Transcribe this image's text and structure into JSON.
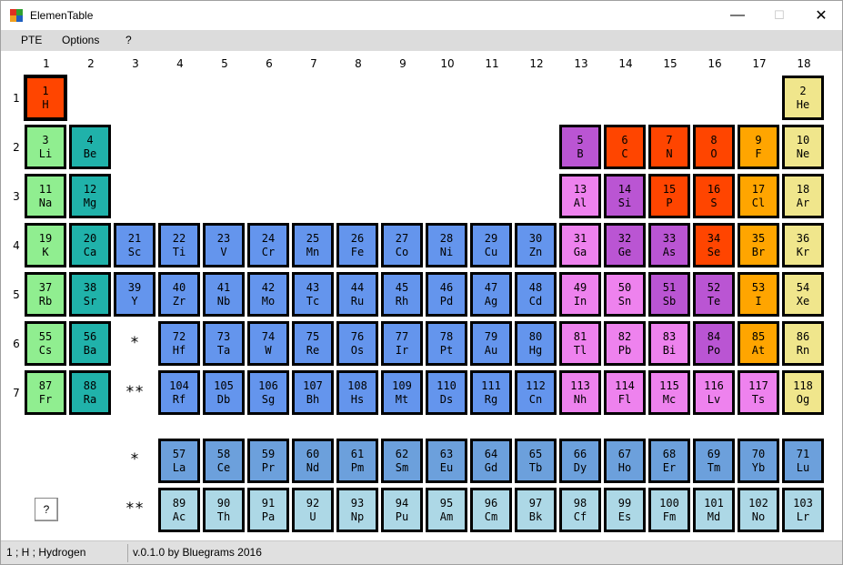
{
  "window": {
    "title": "ElemenTable"
  },
  "controls": {
    "minimize": "—",
    "maximize": "☐",
    "close": "✕"
  },
  "menu": {
    "items": [
      "PTE",
      "Options",
      "?"
    ]
  },
  "groups": [
    "1",
    "2",
    "3",
    "4",
    "5",
    "6",
    "7",
    "8",
    "9",
    "10",
    "11",
    "12",
    "13",
    "14",
    "15",
    "16",
    "17",
    "18"
  ],
  "periods": [
    "1",
    "2",
    "3",
    "4",
    "5",
    "6",
    "7"
  ],
  "markers": {
    "lanthanide": "*",
    "actinide": "**"
  },
  "help_button": "?",
  "colors": {
    "alkali": "#90ee90",
    "alkaline_earth": "#20b2aa",
    "transition": "#6495ed",
    "post_transition": "#ee82ee",
    "metalloid": "#ba55d3",
    "nonmetal": "#ff4500",
    "halogen": "#ffa500",
    "noble_gas": "#f0e68c",
    "lanthanide": "#6ca0dc",
    "actinide": "#add8e6"
  },
  "elements": [
    {
      "n": "1",
      "s": "H",
      "cat": "nonmetal",
      "g": 1,
      "p": 1
    },
    {
      "n": "2",
      "s": "He",
      "cat": "noble_gas",
      "g": 18,
      "p": 1
    },
    {
      "n": "3",
      "s": "Li",
      "cat": "alkali",
      "g": 1,
      "p": 2
    },
    {
      "n": "4",
      "s": "Be",
      "cat": "alkaline_earth",
      "g": 2,
      "p": 2
    },
    {
      "n": "5",
      "s": "B",
      "cat": "metalloid",
      "g": 13,
      "p": 2
    },
    {
      "n": "6",
      "s": "C",
      "cat": "nonmetal",
      "g": 14,
      "p": 2
    },
    {
      "n": "7",
      "s": "N",
      "cat": "nonmetal",
      "g": 15,
      "p": 2
    },
    {
      "n": "8",
      "s": "O",
      "cat": "nonmetal",
      "g": 16,
      "p": 2
    },
    {
      "n": "9",
      "s": "F",
      "cat": "halogen",
      "g": 17,
      "p": 2
    },
    {
      "n": "10",
      "s": "Ne",
      "cat": "noble_gas",
      "g": 18,
      "p": 2
    },
    {
      "n": "11",
      "s": "Na",
      "cat": "alkali",
      "g": 1,
      "p": 3
    },
    {
      "n": "12",
      "s": "Mg",
      "cat": "alkaline_earth",
      "g": 2,
      "p": 3
    },
    {
      "n": "13",
      "s": "Al",
      "cat": "post_transition",
      "g": 13,
      "p": 3
    },
    {
      "n": "14",
      "s": "Si",
      "cat": "metalloid",
      "g": 14,
      "p": 3
    },
    {
      "n": "15",
      "s": "P",
      "cat": "nonmetal",
      "g": 15,
      "p": 3
    },
    {
      "n": "16",
      "s": "S",
      "cat": "nonmetal",
      "g": 16,
      "p": 3
    },
    {
      "n": "17",
      "s": "Cl",
      "cat": "halogen",
      "g": 17,
      "p": 3
    },
    {
      "n": "18",
      "s": "Ar",
      "cat": "noble_gas",
      "g": 18,
      "p": 3
    },
    {
      "n": "19",
      "s": "K",
      "cat": "alkali",
      "g": 1,
      "p": 4
    },
    {
      "n": "20",
      "s": "Ca",
      "cat": "alkaline_earth",
      "g": 2,
      "p": 4
    },
    {
      "n": "21",
      "s": "Sc",
      "cat": "transition",
      "g": 3,
      "p": 4
    },
    {
      "n": "22",
      "s": "Ti",
      "cat": "transition",
      "g": 4,
      "p": 4
    },
    {
      "n": "23",
      "s": "V",
      "cat": "transition",
      "g": 5,
      "p": 4
    },
    {
      "n": "24",
      "s": "Cr",
      "cat": "transition",
      "g": 6,
      "p": 4
    },
    {
      "n": "25",
      "s": "Mn",
      "cat": "transition",
      "g": 7,
      "p": 4
    },
    {
      "n": "26",
      "s": "Fe",
      "cat": "transition",
      "g": 8,
      "p": 4
    },
    {
      "n": "27",
      "s": "Co",
      "cat": "transition",
      "g": 9,
      "p": 4
    },
    {
      "n": "28",
      "s": "Ni",
      "cat": "transition",
      "g": 10,
      "p": 4
    },
    {
      "n": "29",
      "s": "Cu",
      "cat": "transition",
      "g": 11,
      "p": 4
    },
    {
      "n": "30",
      "s": "Zn",
      "cat": "transition",
      "g": 12,
      "p": 4
    },
    {
      "n": "31",
      "s": "Ga",
      "cat": "post_transition",
      "g": 13,
      "p": 4
    },
    {
      "n": "32",
      "s": "Ge",
      "cat": "metalloid",
      "g": 14,
      "p": 4
    },
    {
      "n": "33",
      "s": "As",
      "cat": "metalloid",
      "g": 15,
      "p": 4
    },
    {
      "n": "34",
      "s": "Se",
      "cat": "nonmetal",
      "g": 16,
      "p": 4
    },
    {
      "n": "35",
      "s": "Br",
      "cat": "halogen",
      "g": 17,
      "p": 4
    },
    {
      "n": "36",
      "s": "Kr",
      "cat": "noble_gas",
      "g": 18,
      "p": 4
    },
    {
      "n": "37",
      "s": "Rb",
      "cat": "alkali",
      "g": 1,
      "p": 5
    },
    {
      "n": "38",
      "s": "Sr",
      "cat": "alkaline_earth",
      "g": 2,
      "p": 5
    },
    {
      "n": "39",
      "s": "Y",
      "cat": "transition",
      "g": 3,
      "p": 5
    },
    {
      "n": "40",
      "s": "Zr",
      "cat": "transition",
      "g": 4,
      "p": 5
    },
    {
      "n": "41",
      "s": "Nb",
      "cat": "transition",
      "g": 5,
      "p": 5
    },
    {
      "n": "42",
      "s": "Mo",
      "cat": "transition",
      "g": 6,
      "p": 5
    },
    {
      "n": "43",
      "s": "Tc",
      "cat": "transition",
      "g": 7,
      "p": 5
    },
    {
      "n": "44",
      "s": "Ru",
      "cat": "transition",
      "g": 8,
      "p": 5
    },
    {
      "n": "45",
      "s": "Rh",
      "cat": "transition",
      "g": 9,
      "p": 5
    },
    {
      "n": "46",
      "s": "Pd",
      "cat": "transition",
      "g": 10,
      "p": 5
    },
    {
      "n": "47",
      "s": "Ag",
      "cat": "transition",
      "g": 11,
      "p": 5
    },
    {
      "n": "48",
      "s": "Cd",
      "cat": "transition",
      "g": 12,
      "p": 5
    },
    {
      "n": "49",
      "s": "In",
      "cat": "post_transition",
      "g": 13,
      "p": 5
    },
    {
      "n": "50",
      "s": "Sn",
      "cat": "post_transition",
      "g": 14,
      "p": 5
    },
    {
      "n": "51",
      "s": "Sb",
      "cat": "metalloid",
      "g": 15,
      "p": 5
    },
    {
      "n": "52",
      "s": "Te",
      "cat": "metalloid",
      "g": 16,
      "p": 5
    },
    {
      "n": "53",
      "s": "I",
      "cat": "halogen",
      "g": 17,
      "p": 5
    },
    {
      "n": "54",
      "s": "Xe",
      "cat": "noble_gas",
      "g": 18,
      "p": 5
    },
    {
      "n": "55",
      "s": "Cs",
      "cat": "alkali",
      "g": 1,
      "p": 6
    },
    {
      "n": "56",
      "s": "Ba",
      "cat": "alkaline_earth",
      "g": 2,
      "p": 6
    },
    {
      "n": "72",
      "s": "Hf",
      "cat": "transition",
      "g": 4,
      "p": 6
    },
    {
      "n": "73",
      "s": "Ta",
      "cat": "transition",
      "g": 5,
      "p": 6
    },
    {
      "n": "74",
      "s": "W",
      "cat": "transition",
      "g": 6,
      "p": 6
    },
    {
      "n": "75",
      "s": "Re",
      "cat": "transition",
      "g": 7,
      "p": 6
    },
    {
      "n": "76",
      "s": "Os",
      "cat": "transition",
      "g": 8,
      "p": 6
    },
    {
      "n": "77",
      "s": "Ir",
      "cat": "transition",
      "g": 9,
      "p": 6
    },
    {
      "n": "78",
      "s": "Pt",
      "cat": "transition",
      "g": 10,
      "p": 6
    },
    {
      "n": "79",
      "s": "Au",
      "cat": "transition",
      "g": 11,
      "p": 6
    },
    {
      "n": "80",
      "s": "Hg",
      "cat": "transition",
      "g": 12,
      "p": 6
    },
    {
      "n": "81",
      "s": "Tl",
      "cat": "post_transition",
      "g": 13,
      "p": 6
    },
    {
      "n": "82",
      "s": "Pb",
      "cat": "post_transition",
      "g": 14,
      "p": 6
    },
    {
      "n": "83",
      "s": "Bi",
      "cat": "post_transition",
      "g": 15,
      "p": 6
    },
    {
      "n": "84",
      "s": "Po",
      "cat": "metalloid",
      "g": 16,
      "p": 6
    },
    {
      "n": "85",
      "s": "At",
      "cat": "halogen",
      "g": 17,
      "p": 6
    },
    {
      "n": "86",
      "s": "Rn",
      "cat": "noble_gas",
      "g": 18,
      "p": 6
    },
    {
      "n": "87",
      "s": "Fr",
      "cat": "alkali",
      "g": 1,
      "p": 7
    },
    {
      "n": "88",
      "s": "Ra",
      "cat": "alkaline_earth",
      "g": 2,
      "p": 7
    },
    {
      "n": "104",
      "s": "Rf",
      "cat": "transition",
      "g": 4,
      "p": 7
    },
    {
      "n": "105",
      "s": "Db",
      "cat": "transition",
      "g": 5,
      "p": 7
    },
    {
      "n": "106",
      "s": "Sg",
      "cat": "transition",
      "g": 6,
      "p": 7
    },
    {
      "n": "107",
      "s": "Bh",
      "cat": "transition",
      "g": 7,
      "p": 7
    },
    {
      "n": "108",
      "s": "Hs",
      "cat": "transition",
      "g": 8,
      "p": 7
    },
    {
      "n": "109",
      "s": "Mt",
      "cat": "transition",
      "g": 9,
      "p": 7
    },
    {
      "n": "110",
      "s": "Ds",
      "cat": "transition",
      "g": 10,
      "p": 7
    },
    {
      "n": "111",
      "s": "Rg",
      "cat": "transition",
      "g": 11,
      "p": 7
    },
    {
      "n": "112",
      "s": "Cn",
      "cat": "transition",
      "g": 12,
      "p": 7
    },
    {
      "n": "113",
      "s": "Nh",
      "cat": "post_transition",
      "g": 13,
      "p": 7
    },
    {
      "n": "114",
      "s": "Fl",
      "cat": "post_transition",
      "g": 14,
      "p": 7
    },
    {
      "n": "115",
      "s": "Mc",
      "cat": "post_transition",
      "g": 15,
      "p": 7
    },
    {
      "n": "116",
      "s": "Lv",
      "cat": "post_transition",
      "g": 16,
      "p": 7
    },
    {
      "n": "117",
      "s": "Ts",
      "cat": "post_transition",
      "g": 17,
      "p": 7
    },
    {
      "n": "118",
      "s": "Og",
      "cat": "noble_gas",
      "g": 18,
      "p": 7
    }
  ],
  "lanthanides": [
    {
      "n": "57",
      "s": "La"
    },
    {
      "n": "58",
      "s": "Ce"
    },
    {
      "n": "59",
      "s": "Pr"
    },
    {
      "n": "60",
      "s": "Nd"
    },
    {
      "n": "61",
      "s": "Pm"
    },
    {
      "n": "62",
      "s": "Sm"
    },
    {
      "n": "63",
      "s": "Eu"
    },
    {
      "n": "64",
      "s": "Gd"
    },
    {
      "n": "65",
      "s": "Tb"
    },
    {
      "n": "66",
      "s": "Dy"
    },
    {
      "n": "67",
      "s": "Ho"
    },
    {
      "n": "68",
      "s": "Er"
    },
    {
      "n": "69",
      "s": "Tm"
    },
    {
      "n": "70",
      "s": "Yb"
    },
    {
      "n": "71",
      "s": "Lu"
    }
  ],
  "actinides": [
    {
      "n": "89",
      "s": "Ac"
    },
    {
      "n": "90",
      "s": "Th"
    },
    {
      "n": "91",
      "s": "Pa"
    },
    {
      "n": "92",
      "s": "U"
    },
    {
      "n": "93",
      "s": "Np"
    },
    {
      "n": "94",
      "s": "Pu"
    },
    {
      "n": "95",
      "s": "Am"
    },
    {
      "n": "96",
      "s": "Cm"
    },
    {
      "n": "97",
      "s": "Bk"
    },
    {
      "n": "98",
      "s": "Cf"
    },
    {
      "n": "99",
      "s": "Es"
    },
    {
      "n": "100",
      "s": "Fm"
    },
    {
      "n": "101",
      "s": "Md"
    },
    {
      "n": "102",
      "s": "No"
    },
    {
      "n": "103",
      "s": "Lr"
    }
  ],
  "selected_element": "1",
  "status": {
    "selection": "1 ; H ; Hydrogen",
    "version": "v.0.1.0 by Bluegrams 2016"
  }
}
